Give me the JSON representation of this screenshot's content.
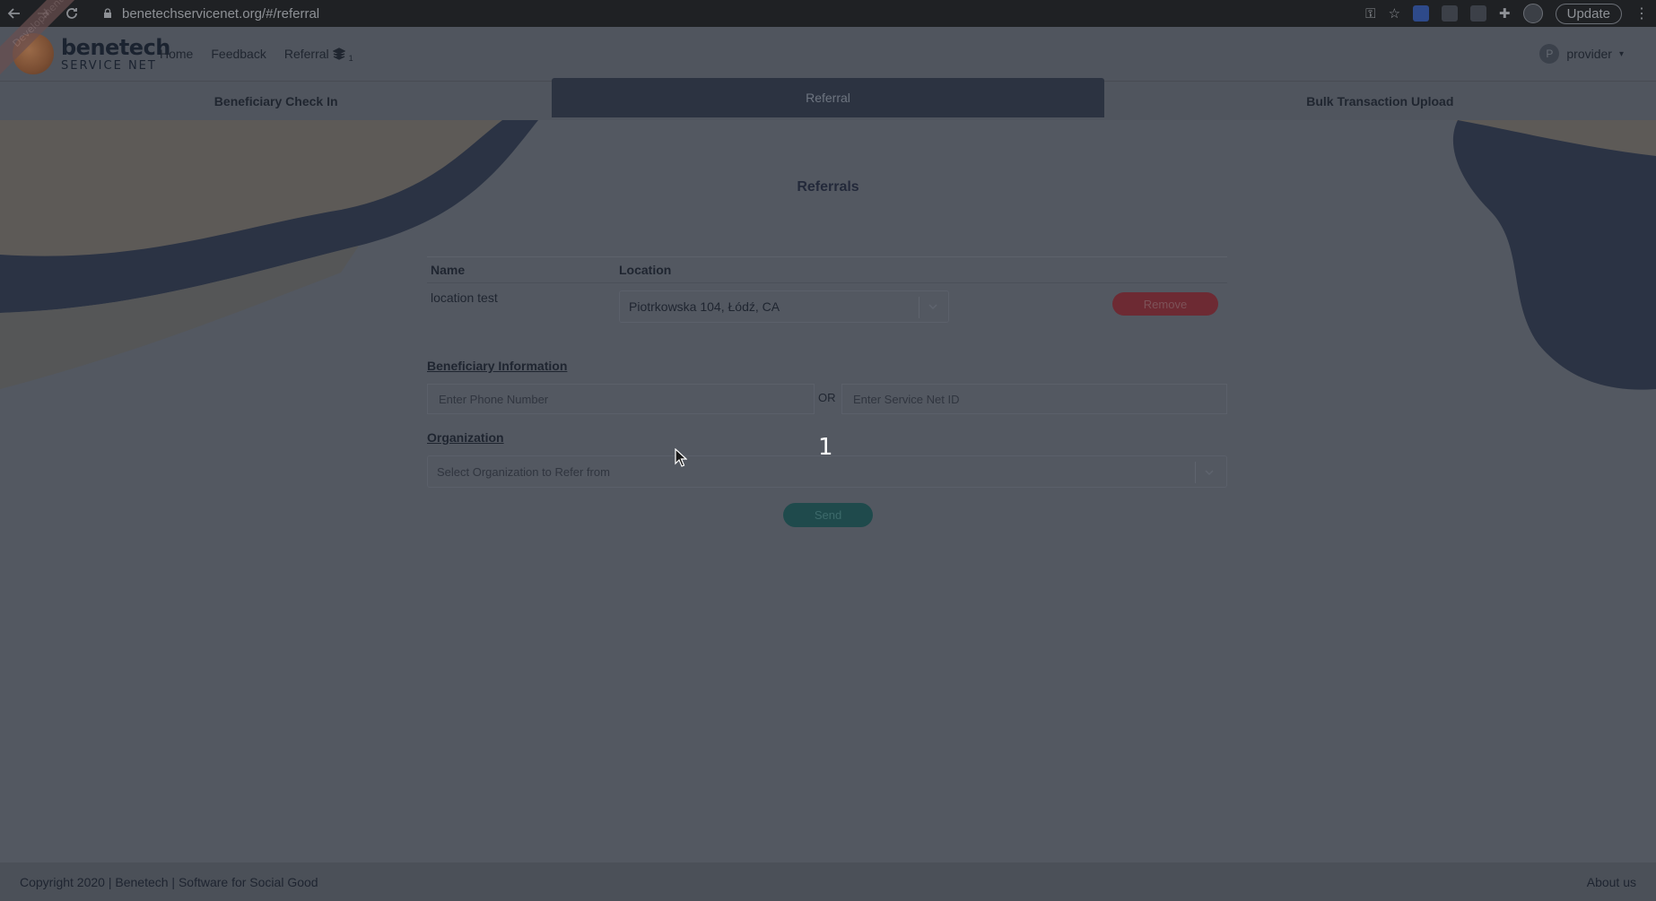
{
  "browser": {
    "url": "benetechservicenet.org/#/referral",
    "update_label": "Update"
  },
  "header": {
    "logo_line1": "benetech",
    "logo_line2": "SERVICE NET",
    "ribbon": "Development",
    "nav": {
      "home": "Home",
      "feedback": "Feedback",
      "referral": "Referral",
      "referral_badge": "1"
    },
    "user": {
      "initial": "P",
      "name": "provider"
    }
  },
  "tabs": [
    {
      "label": "Beneficiary Check In"
    },
    {
      "label": "Referral"
    },
    {
      "label": "Bulk Transaction Upload"
    }
  ],
  "main": {
    "title": "Referrals",
    "table": {
      "headers": {
        "name": "Name",
        "location": "Location"
      },
      "rows": [
        {
          "name": "location test",
          "location": "Piotrkowska 104, Łódź, CA",
          "action": "Remove"
        }
      ]
    },
    "beneficiary": {
      "label": "Beneficiary Information",
      "phone_placeholder": "Enter Phone Number",
      "or": "OR",
      "id_placeholder": "Enter Service Net ID"
    },
    "organization": {
      "label": "Organization",
      "placeholder": "Select Organization to Refer from"
    },
    "send": "Send",
    "step_overlay": "1"
  },
  "footer": {
    "copyright": "Copyright 2020 | Benetech | Software for Social Good",
    "about": "About us"
  },
  "colors": {
    "overlay_bg": "#535861",
    "active_tab": "#2c3341",
    "remove": "#6d2a33",
    "send": "#1f4a4c"
  }
}
